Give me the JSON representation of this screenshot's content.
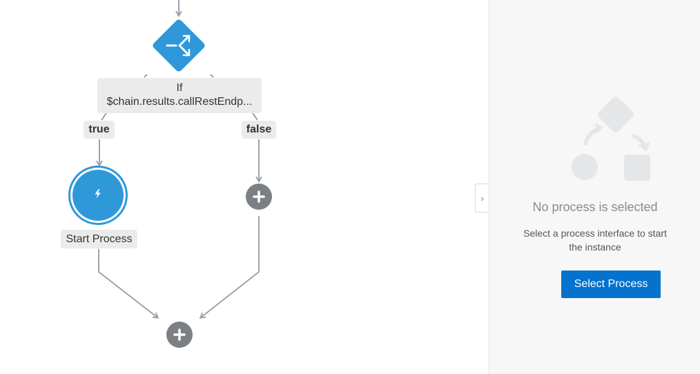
{
  "flow": {
    "if_node": {
      "keyword": "If",
      "condition": "$chain.results.callRestEndp..."
    },
    "branches": {
      "true_label": "true",
      "false_label": "false"
    },
    "start_process": {
      "label": "Start Process",
      "icon": "lightning-bolt-icon"
    },
    "switch_icon": "switch-arrows-icon",
    "add_icon": "plus-icon"
  },
  "panel": {
    "empty_title": "No process is selected",
    "empty_description": "Select a process interface to start the instance",
    "select_button": "Select Process",
    "collapse_icon": "chevron-right-icon"
  },
  "colors": {
    "accent_blue": "#2e98d9",
    "button_blue": "#0572ce",
    "add_gray": "#7c7f83",
    "connector_gray": "#9aa3ac"
  }
}
